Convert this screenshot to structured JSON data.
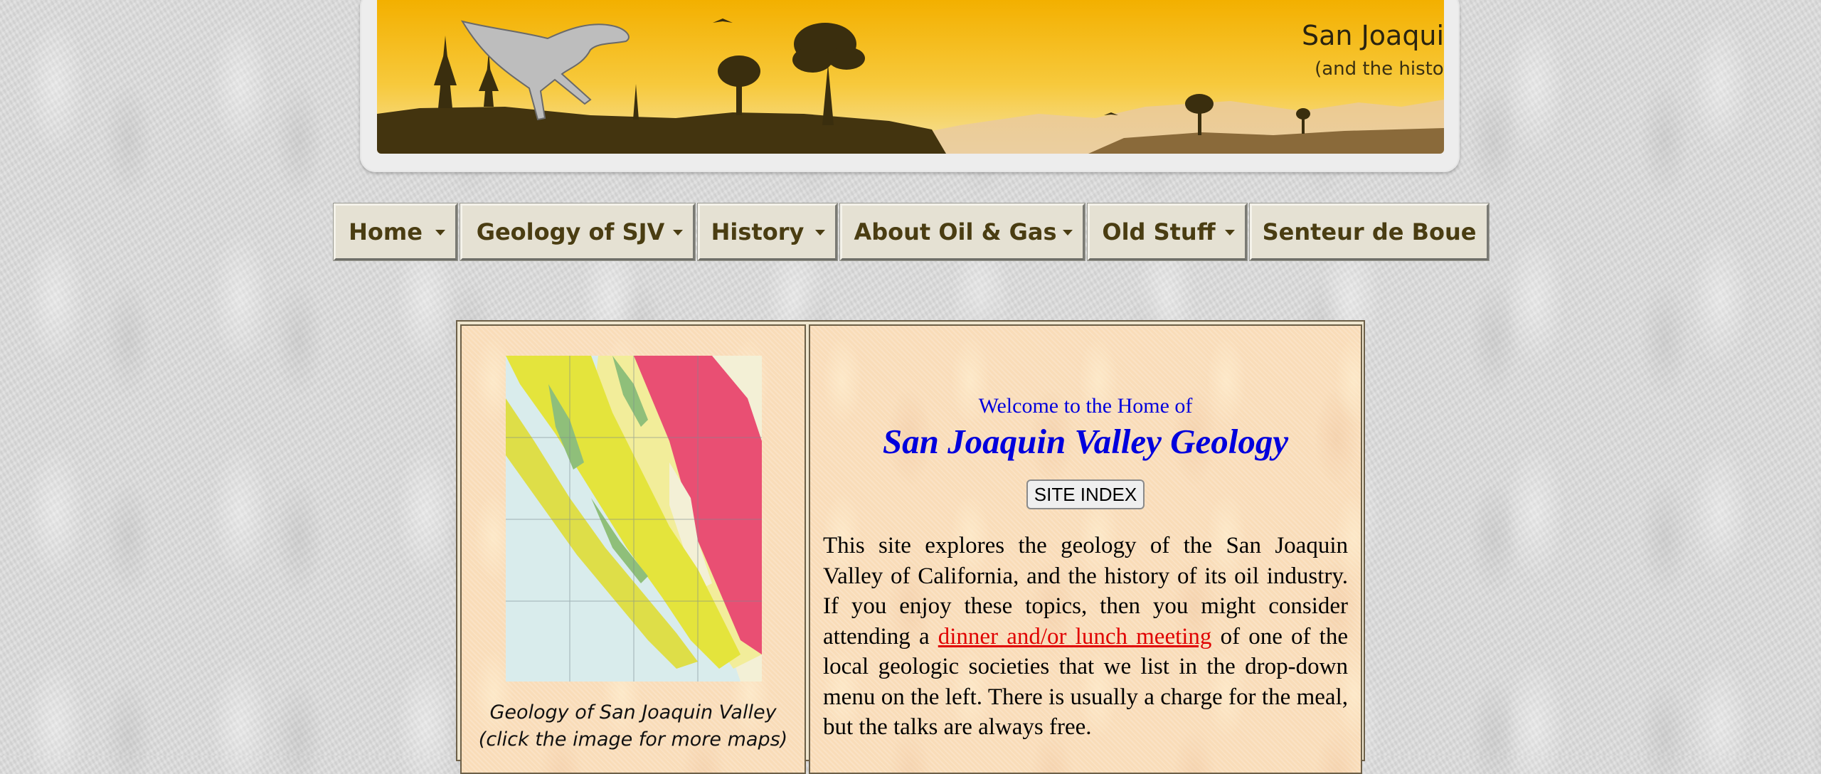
{
  "banner": {
    "title": "San Joaquin Valley Geology",
    "subtitle": "(and the history of its oil industry)"
  },
  "nav": {
    "items": [
      {
        "label": "Home"
      },
      {
        "label": "Geology of SJV"
      },
      {
        "label": "History"
      },
      {
        "label": "About Oil & Gas"
      },
      {
        "label": "Old Stuff"
      },
      {
        "label": "Senteur de Boue"
      }
    ]
  },
  "left": {
    "caption_line1": "Geology of San Joaquin Valley",
    "caption_line2": "(click the image for more maps)"
  },
  "main": {
    "welcome": "Welcome to the Home of",
    "title": "San Joaquin Valley Geology",
    "site_index_label": "SITE INDEX",
    "intro_part1": "This site explores the geology of the San Joaquin Valley of California, and the history of its oil industry. If you enjoy these topics, then you might consider attending a ",
    "intro_link": "dinner and/or lunch meeting",
    "intro_part2": " of one of the local geologic societies that we list in the drop-down menu on the left. There is usually a charge for the meal, but the talks are always free."
  },
  "colors": {
    "banner_sky": "#f5b400",
    "banner_ground": "#4a3a14",
    "nav_bg": "#e5e1d3",
    "nav_text": "#4a3d12",
    "title_blue": "#0000dd",
    "link_red": "#e00000"
  }
}
